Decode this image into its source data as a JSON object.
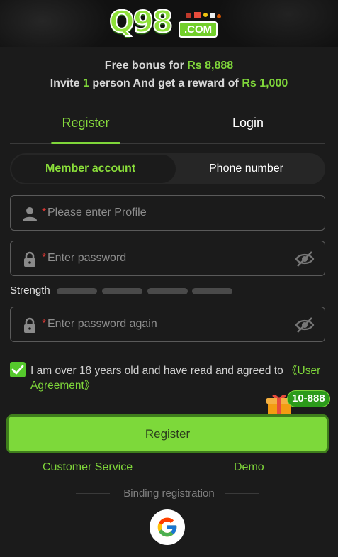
{
  "logo": {
    "main": "Q98",
    "suffix": ".COM"
  },
  "bonus": {
    "line1_prefix": "Free bonus for ",
    "line1_amount": "Rs 8,888",
    "line2_prefix": "Invite ",
    "line2_count": "1",
    "line2_middle": " person And get a reward of ",
    "line2_amount": "Rs 1,000"
  },
  "tabs": {
    "register": "Register",
    "login": "Login"
  },
  "segment": {
    "member": "Member account",
    "phone": "Phone number"
  },
  "fields": {
    "profile": {
      "required_mark": "*",
      "placeholder": "Please enter Profile",
      "value": ""
    },
    "password": {
      "required_mark": "*",
      "placeholder": "Enter password",
      "value": ""
    },
    "password_again": {
      "required_mark": "*",
      "placeholder": "Enter password again",
      "value": ""
    }
  },
  "strength": {
    "label": "Strength",
    "level": 0,
    "max": 4
  },
  "agreement": {
    "checked": true,
    "text": "I am over 18 years old and have read and agreed to ",
    "link": "《User Agreement》"
  },
  "gift": {
    "badge": "10-888"
  },
  "register_button": "Register",
  "links": {
    "customer_service": "Customer Service",
    "demo": "Demo"
  },
  "binding": {
    "label": "Binding registration"
  },
  "colors": {
    "accent": "#7fd63a",
    "background": "#1b1b1b",
    "required": "#e53935"
  },
  "icons": [
    "user-icon",
    "lock-icon",
    "eye-off-icon",
    "check-icon",
    "gift-icon",
    "google-icon"
  ]
}
